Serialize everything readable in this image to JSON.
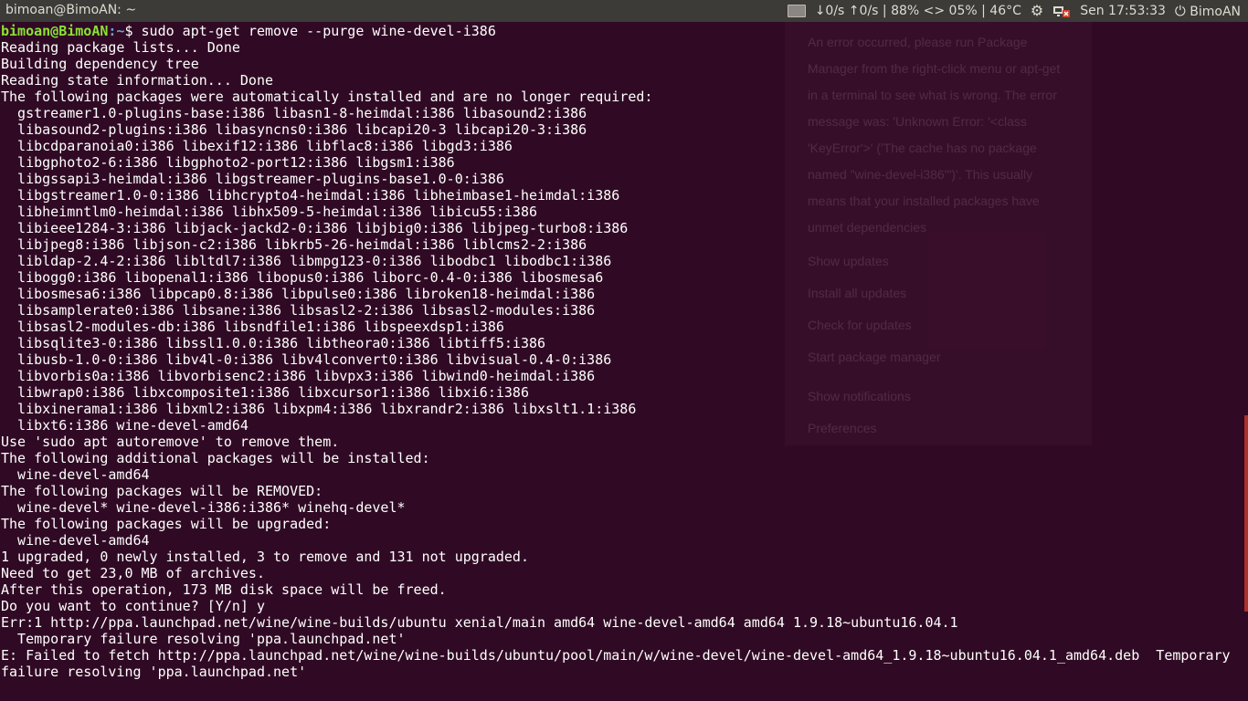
{
  "window": {
    "title": "bimoan@BimoAN: ~"
  },
  "topbar": {
    "network_speed": "↓0/s ↑0/s | 88% <> 05% | 46°C",
    "clock": "Sen 17:53:33",
    "user": "BimoAN"
  },
  "terminal": {
    "prompt_user": "bimoan@BimoAN",
    "prompt_path": ":~",
    "prompt_symbol": "$ ",
    "command": "sudo apt-get remove --purge wine-devel-i386",
    "output": "Reading package lists... Done\nBuilding dependency tree\nReading state information... Done\nThe following packages were automatically installed and are no longer required:\n  gstreamer1.0-plugins-base:i386 libasn1-8-heimdal:i386 libasound2:i386\n  libasound2-plugins:i386 libasyncns0:i386 libcapi20-3 libcapi20-3:i386\n  libcdparanoia0:i386 libexif12:i386 libflac8:i386 libgd3:i386\n  libgphoto2-6:i386 libgphoto2-port12:i386 libgsm1:i386\n  libgssapi3-heimdal:i386 libgstreamer-plugins-base1.0-0:i386\n  libgstreamer1.0-0:i386 libhcrypto4-heimdal:i386 libheimbase1-heimdal:i386\n  libheimntlm0-heimdal:i386 libhx509-5-heimdal:i386 libicu55:i386\n  libieee1284-3:i386 libjack-jackd2-0:i386 libjbig0:i386 libjpeg-turbo8:i386\n  libjpeg8:i386 libjson-c2:i386 libkrb5-26-heimdal:i386 liblcms2-2:i386\n  libldap-2.4-2:i386 libltdl7:i386 libmpg123-0:i386 libodbc1 libodbc1:i386\n  libogg0:i386 libopenal1:i386 libopus0:i386 liborc-0.4-0:i386 libosmesa6\n  libosmesa6:i386 libpcap0.8:i386 libpulse0:i386 libroken18-heimdal:i386\n  libsamplerate0:i386 libsane:i386 libsasl2-2:i386 libsasl2-modules:i386\n  libsasl2-modules-db:i386 libsndfile1:i386 libspeexdsp1:i386\n  libsqlite3-0:i386 libssl1.0.0:i386 libtheora0:i386 libtiff5:i386\n  libusb-1.0-0:i386 libv4l-0:i386 libv4lconvert0:i386 libvisual-0.4-0:i386\n  libvorbis0a:i386 libvorbisenc2:i386 libvpx3:i386 libwind0-heimdal:i386\n  libwrap0:i386 libxcomposite1:i386 libxcursor1:i386 libxi6:i386\n  libxinerama1:i386 libxml2:i386 libxpm4:i386 libxrandr2:i386 libxslt1.1:i386\n  libxt6:i386 wine-devel-amd64\nUse 'sudo apt autoremove' to remove them.\nThe following additional packages will be installed:\n  wine-devel-amd64\nThe following packages will be REMOVED:\n  wine-devel* wine-devel-i386:i386* winehq-devel*\nThe following packages will be upgraded:\n  wine-devel-amd64\n1 upgraded, 0 newly installed, 3 to remove and 131 not upgraded.\nNeed to get 23,0 MB of archives.\nAfter this operation, 173 MB disk space will be freed.\nDo you want to continue? [Y/n] y\nErr:1 http://ppa.launchpad.net/wine/wine-builds/ubuntu xenial/main amd64 wine-devel-amd64 amd64 1.9.18~ubuntu16.04.1\n  Temporary failure resolving 'ppa.launchpad.net'\nE: Failed to fetch http://ppa.launchpad.net/wine/wine-builds/ubuntu/pool/main/w/wine-devel/wine-devel-amd64_1.9.18~ubuntu16.04.1_amd64.deb  Temporary\nfailure resolving 'ppa.launchpad.net'"
  },
  "update_menu": {
    "error_message": "An error occurred, please run Package Manager from the right-click menu or apt-get in a terminal to see what is wrong. The error message was: 'Unknown Error: '<class 'KeyError'>' ('The cache has no package named \"wine-devel-i386\"')'. This usually means that your installed packages have unmet dependencies",
    "items": [
      {
        "label": "Show updates"
      },
      {
        "label": "Install all updates"
      },
      {
        "label": "Check for updates"
      },
      {
        "label": "Start package manager"
      },
      {
        "label": "Show notifications"
      },
      {
        "label": "Preferences"
      }
    ]
  },
  "colors": {
    "terminal_bg": "#300a24",
    "prompt_user": "#8ae234",
    "prompt_path": "#729fcf",
    "topbar_bg": "#3c3b37"
  }
}
